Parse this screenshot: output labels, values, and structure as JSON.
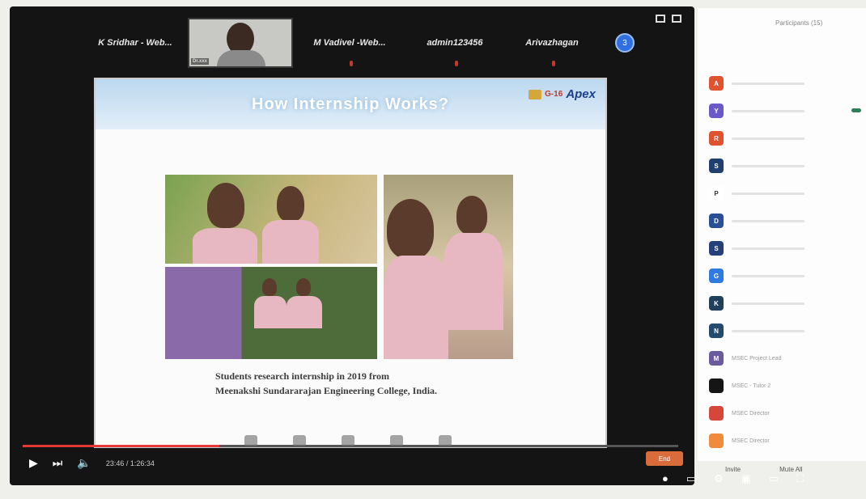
{
  "meeting": {
    "participants_tiles": [
      {
        "name": "K Sridhar - Web..."
      },
      {
        "name": "M Vadivel -Web..."
      },
      {
        "name": "admin123456"
      },
      {
        "name": "Arivazhagan"
      }
    ],
    "video_tile_label": "Dr.xxx",
    "participants_count_badge": "3"
  },
  "slide": {
    "title": "How Internship Works?",
    "logo_text": "Apex",
    "logo_small": "G-16",
    "caption_line1": "Students research internship in 2019 from",
    "caption_line2": "Meenakshi Sundararajan Engineering College, India."
  },
  "player": {
    "time": "23:46 / 1:26:34",
    "progress_percent": 30,
    "end_button": "End",
    "left_marker_a": "1",
    "left_marker_b": "#1"
  },
  "panel": {
    "title": "Participants (15)",
    "footer_left": "Invite",
    "footer_right": "Mute All",
    "participants": [
      {
        "initial": "A",
        "color": "#e0532f",
        "name": ""
      },
      {
        "initial": "Y",
        "color": "#6c59c9",
        "name": ""
      },
      {
        "initial": "R",
        "color": "#e0532f",
        "name": ""
      },
      {
        "initial": "S",
        "color": "#1f3f70",
        "name": ""
      },
      {
        "initial": "P",
        "color": "#ffffff",
        "name": ""
      },
      {
        "initial": "D",
        "color": "#2a4f96",
        "name": ""
      },
      {
        "initial": "S",
        "color": "#24407a",
        "name": ""
      },
      {
        "initial": "G",
        "color": "#2f79e0",
        "name": ""
      },
      {
        "initial": "K",
        "color": "#1f3f5a",
        "name": ""
      },
      {
        "initial": "N",
        "color": "#244b6e",
        "name": ""
      },
      {
        "initial": "M",
        "color": "#6a5a9e",
        "name": "MSEC Project Lead"
      },
      {
        "initial": "",
        "color": "#151515",
        "name": "MSEC - Tutor 2"
      },
      {
        "initial": "",
        "color": "#d6473a",
        "name": "MSEC Director"
      },
      {
        "initial": "",
        "color": "#f08a3c",
        "name": "MSEC Director"
      }
    ]
  }
}
